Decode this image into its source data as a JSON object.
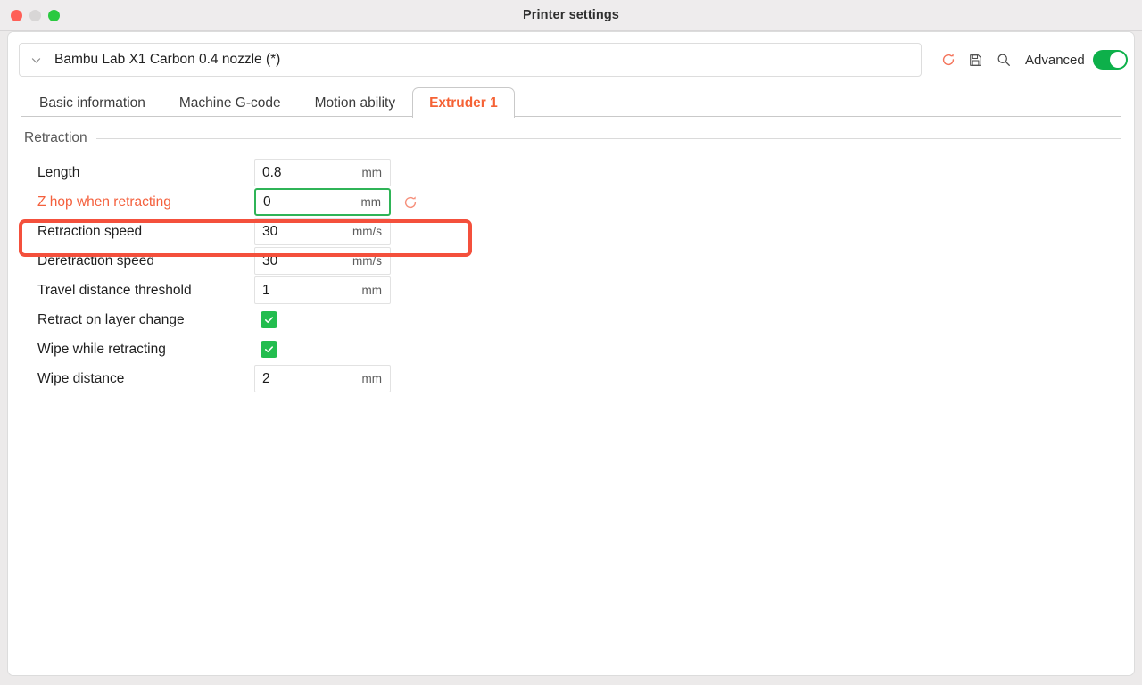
{
  "window": {
    "title": "Printer settings",
    "controls": {
      "close": "close-button",
      "minimize": "minimize-button",
      "maximize": "maximize-button"
    }
  },
  "preset": {
    "name": "Bambu Lab X1 Carbon 0.4 nozzle (*)",
    "dropdown_icon": "chevron-down-icon",
    "tools": {
      "reset_icon": "reset-circular-arrow-icon",
      "save_icon": "save-floppy-icon",
      "search_icon": "search-magnifier-icon",
      "advanced_label": "Advanced",
      "advanced_enabled": true
    }
  },
  "tabs": [
    {
      "label": "Basic information",
      "active": false
    },
    {
      "label": "Machine G-code",
      "active": false
    },
    {
      "label": "Motion ability",
      "active": false
    },
    {
      "label": "Extruder 1",
      "active": true
    }
  ],
  "section": {
    "title": "Retraction"
  },
  "settings": [
    {
      "label": "Length",
      "type": "number",
      "value": "0.8",
      "unit": "mm",
      "highlighted": false,
      "focused": false,
      "reset": false
    },
    {
      "label": "Z hop when retracting",
      "type": "number",
      "value": "0",
      "unit": "mm",
      "highlighted": true,
      "focused": true,
      "reset": true
    },
    {
      "label": "Retraction speed",
      "type": "number",
      "value": "30",
      "unit": "mm/s",
      "highlighted": false,
      "focused": false,
      "reset": false
    },
    {
      "label": "Deretraction speed",
      "type": "number",
      "value": "30",
      "unit": "mm/s",
      "highlighted": false,
      "focused": false,
      "reset": false
    },
    {
      "label": "Travel distance threshold",
      "type": "number",
      "value": "1",
      "unit": "mm",
      "highlighted": false,
      "focused": false,
      "reset": false
    },
    {
      "label": "Retract on layer change",
      "type": "checkbox",
      "value": true,
      "unit": "",
      "highlighted": false,
      "focused": false,
      "reset": false
    },
    {
      "label": "Wipe while retracting",
      "type": "checkbox",
      "value": true,
      "unit": "",
      "highlighted": false,
      "focused": false,
      "reset": false
    },
    {
      "label": "Wipe distance",
      "type": "number",
      "value": "2",
      "unit": "mm",
      "highlighted": false,
      "focused": false,
      "reset": false
    }
  ],
  "colors": {
    "accent_orange": "#f56235",
    "annotation_red": "#f4503c",
    "toggle_green": "#0db04a",
    "checkbox_green": "#22bd4e",
    "focus_green": "#2fb457",
    "close_red": "#ff5f57",
    "minimize_gray": "#d8d6d6",
    "maximize_green": "#2ac940"
  }
}
